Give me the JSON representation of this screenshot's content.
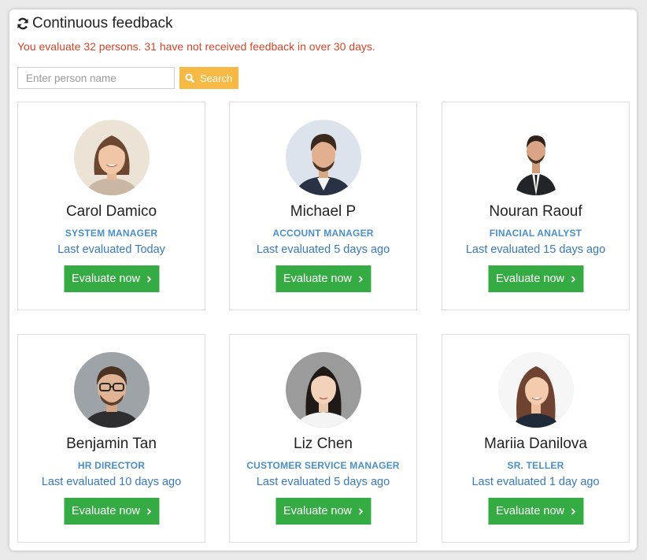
{
  "header": {
    "title": "Continuous feedback",
    "icon": "refresh-icon"
  },
  "alert": {
    "text": "You evaluate 32 persons. 31 have not received feedback in over 30 days.",
    "color": "#d0462a"
  },
  "search": {
    "placeholder": "Enter person name",
    "value": "",
    "button_label": "Search",
    "button_icon": "search-icon",
    "button_color": "#f5b944"
  },
  "colors": {
    "accent_green": "#35ab44",
    "role_blue": "#4a8fc6",
    "link_blue": "#3a7ab5"
  },
  "people": [
    {
      "name": "Carol Damico",
      "role": "SYSTEM MANAGER",
      "last": "Last evaluated Today",
      "button": "Evaluate now"
    },
    {
      "name": "Michael P",
      "role": "ACCOUNT MANAGER",
      "last": "Last evaluated 5 days ago",
      "button": "Evaluate now"
    },
    {
      "name": "Nouran Raouf",
      "role": "FINACIAL ANALYST",
      "last": "Last evaluated 15 days ago",
      "button": "Evaluate now"
    },
    {
      "name": "Benjamin Tan",
      "role": "HR DIRECTOR",
      "last": "Last evaluated 10 days ago",
      "button": "Evaluate now"
    },
    {
      "name": "Liz Chen",
      "role": "CUSTOMER SERVICE MANAGER",
      "last": "Last evaluated 5 days ago",
      "button": "Evaluate now"
    },
    {
      "name": "Mariia Danilova",
      "role": "SR. TELLER",
      "last": "Last evaluated 1 day ago",
      "button": "Evaluate now"
    }
  ]
}
